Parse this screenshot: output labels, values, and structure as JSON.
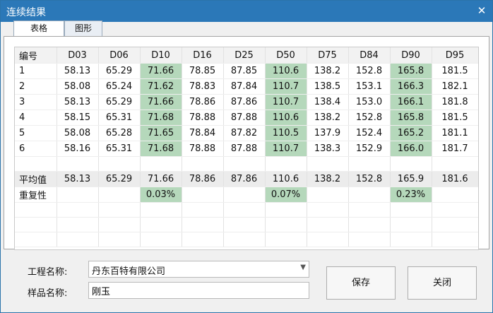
{
  "window": {
    "title": "连续结果",
    "close_glyph": "✕"
  },
  "tabs": [
    {
      "label": "表格"
    },
    {
      "label": "图形"
    }
  ],
  "table": {
    "headers": [
      "编号",
      "D03",
      "D06",
      "D10",
      "D16",
      "D25",
      "D50",
      "D75",
      "D84",
      "D90",
      "D95"
    ],
    "rows": [
      [
        "1",
        "58.13",
        "65.29",
        "71.66",
        "78.85",
        "87.85",
        "110.6",
        "138.2",
        "152.8",
        "165.8",
        "181.5"
      ],
      [
        "2",
        "58.08",
        "65.24",
        "71.62",
        "78.83",
        "87.84",
        "110.7",
        "138.5",
        "153.1",
        "166.3",
        "182.1"
      ],
      [
        "3",
        "58.13",
        "65.29",
        "71.66",
        "78.86",
        "87.86",
        "110.7",
        "138.4",
        "153.0",
        "166.1",
        "181.8"
      ],
      [
        "4",
        "58.15",
        "65.31",
        "71.68",
        "78.88",
        "87.88",
        "110.6",
        "138.2",
        "152.8",
        "165.8",
        "181.5"
      ],
      [
        "5",
        "58.08",
        "65.28",
        "71.65",
        "78.84",
        "87.82",
        "110.5",
        "137.9",
        "152.4",
        "165.2",
        "181.1"
      ],
      [
        "6",
        "58.16",
        "65.31",
        "71.68",
        "78.88",
        "87.88",
        "110.7",
        "138.3",
        "152.9",
        "166.0",
        "181.7"
      ]
    ],
    "avg": [
      "平均值",
      "58.13",
      "65.29",
      "71.66",
      "78.86",
      "87.86",
      "110.6",
      "138.2",
      "152.8",
      "165.9",
      "181.6"
    ],
    "repeat": [
      "重复性",
      "",
      "",
      "0.03%",
      "",
      "",
      "0.07%",
      "",
      "",
      "0.23%",
      ""
    ],
    "highlight_color": "#b5d8bb"
  },
  "form": {
    "project_label": "工程名称:",
    "project_value": "丹东百特有限公司",
    "sample_label": "样品名称:",
    "sample_value": "刚玉"
  },
  "buttons": {
    "save": "保存",
    "close": "关闭"
  }
}
